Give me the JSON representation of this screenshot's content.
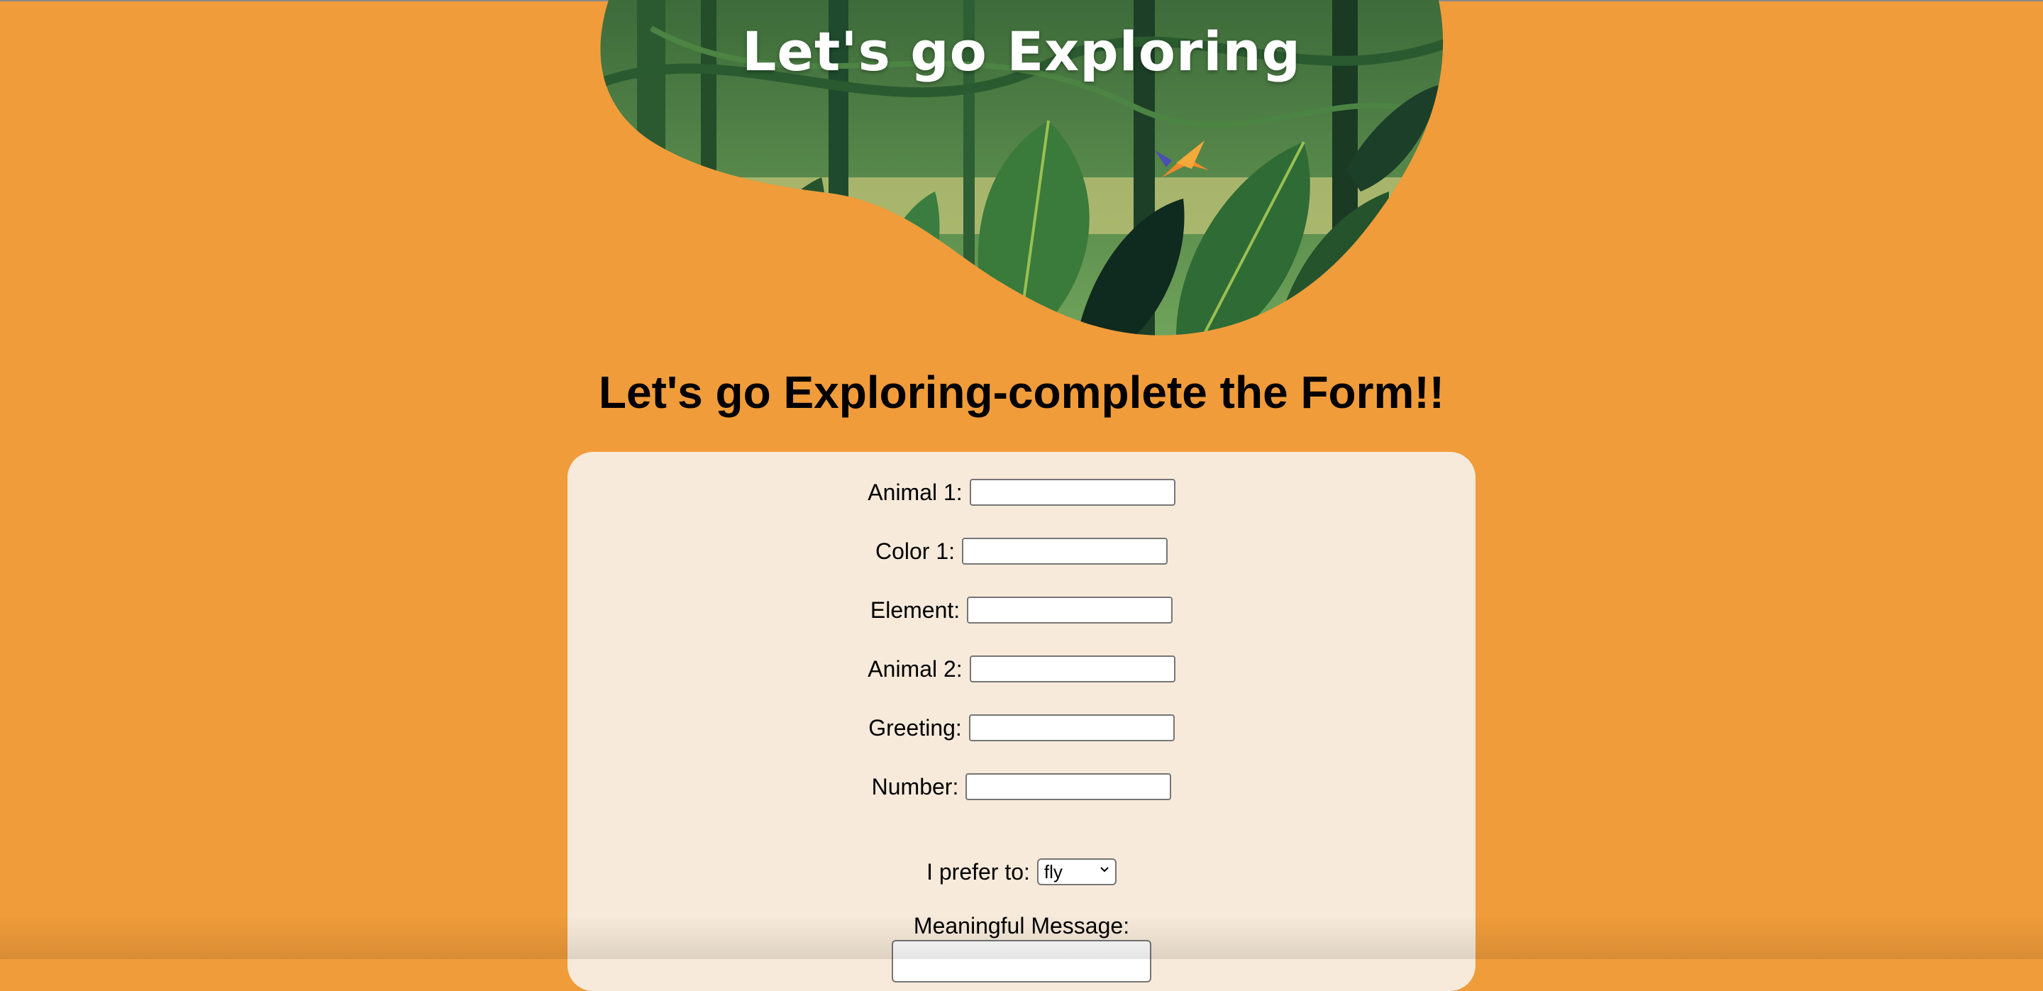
{
  "hero": {
    "title": "Let's go Exploring"
  },
  "page": {
    "heading": "Let's go Exploring-complete the Form!!"
  },
  "form": {
    "fields": [
      {
        "label": "Animal 1:",
        "value": ""
      },
      {
        "label": "Color 1:",
        "value": ""
      },
      {
        "label": "Element:",
        "value": ""
      },
      {
        "label": "Animal 2:",
        "value": ""
      },
      {
        "label": "Greeting:",
        "value": ""
      },
      {
        "label": "Number:",
        "value": ""
      }
    ],
    "prefer": {
      "label": "I prefer to:",
      "selected": "fly"
    },
    "message": {
      "label": "Meaningful Message:",
      "value": ""
    }
  },
  "colors": {
    "background": "#f09c3a",
    "card": "#f7eada",
    "jungle_dark": "#1f4a2e",
    "jungle_mid": "#3f7a3c",
    "jungle_light": "#6fa35a"
  }
}
